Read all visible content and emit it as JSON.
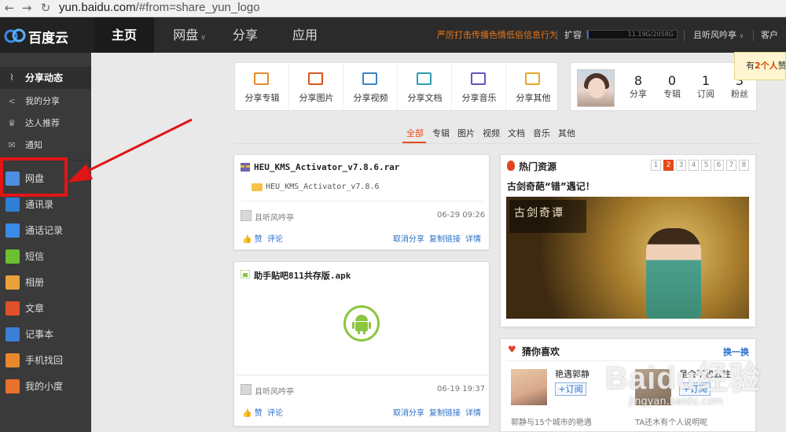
{
  "browser": {
    "url_host": "yun.baidu.com",
    "url_path": "/#from=share_yun_logo"
  },
  "navbar": {
    "logo_text": "百度云",
    "tabs": [
      {
        "label": "主页"
      },
      {
        "label": "网盘"
      },
      {
        "label": "分享"
      },
      {
        "label": "应用"
      }
    ],
    "warning": "严厉打击传播色情低俗信息行为",
    "expand": "扩容",
    "quota_text": "11.19G/2058G",
    "quota_fraction": 0.0054,
    "username": "且听风吟亭",
    "client": "客户端"
  },
  "sidebar": {
    "items": [
      {
        "label": "分享动态"
      },
      {
        "label": "我的分享"
      },
      {
        "label": "达人推荐"
      },
      {
        "label": "通知"
      },
      {
        "label": "网盘"
      },
      {
        "label": "通讯录"
      },
      {
        "label": "通话记录"
      },
      {
        "label": "短信"
      },
      {
        "label": "相册"
      },
      {
        "label": "文章"
      },
      {
        "label": "记事本"
      },
      {
        "label": "手机找回"
      },
      {
        "label": "我的小度"
      }
    ]
  },
  "share_types": [
    {
      "label": "分享专辑"
    },
    {
      "label": "分享图片"
    },
    {
      "label": "分享视频"
    },
    {
      "label": "分享文档"
    },
    {
      "label": "分享音乐"
    },
    {
      "label": "分享其他"
    }
  ],
  "profile": {
    "stats": [
      {
        "value": "8",
        "label": "分享"
      },
      {
        "value": "0",
        "label": "专辑"
      },
      {
        "value": "1",
        "label": "订阅"
      },
      {
        "value": "3",
        "label": "粉丝"
      }
    ]
  },
  "toast": {
    "prefix": "有",
    "count": "2个人",
    "suffix": "赞"
  },
  "filters": [
    "全部",
    "专辑",
    "图片",
    "视频",
    "文档",
    "音乐",
    "其他"
  ],
  "feed": [
    {
      "title": "HEU_KMS_Activator_v7.8.6.rar",
      "folder": "HEU_KMS_Activator_v7.8.6",
      "user": "且听风吟亭",
      "time": "06-29 09:26",
      "like": "赞",
      "comment": "评论",
      "cancel": "取消分享",
      "copy": "复制链接",
      "detail": "详情"
    },
    {
      "title": "助手贴吧811共存版.apk",
      "user": "且听风吟亭",
      "time": "06-19 19:37",
      "like": "赞",
      "comment": "评论",
      "cancel": "取消分享",
      "copy": "复制链接",
      "detail": "详情"
    }
  ],
  "hot": {
    "title": "热门资源",
    "pages": [
      "1",
      "2",
      "3",
      "4",
      "5",
      "6",
      "7",
      "8"
    ],
    "active_page": "2",
    "subtitle": "古剑奇葩“错”遇记！",
    "image_caption": "古剑奇谭"
  },
  "guess": {
    "title": "猜你喜欢",
    "refresh": "换一换",
    "users": [
      {
        "name": "艳遇郭静",
        "follow": "订阅",
        "desc": "郭静与15个城市的艳遇"
      },
      {
        "name": "是会不聪云往",
        "follow": "订阅",
        "desc": "TA还木有个人说明呢"
      }
    ]
  },
  "watermark": {
    "brand": "Baidu经验",
    "url": "jingyan.baidu.com"
  },
  "colors": {
    "accent": "#e64a19",
    "link": "#2a6fc9",
    "highlight": "#e01515",
    "nav_bg": "#2b2b2b",
    "sidebar_bg": "#3a3a3a"
  }
}
